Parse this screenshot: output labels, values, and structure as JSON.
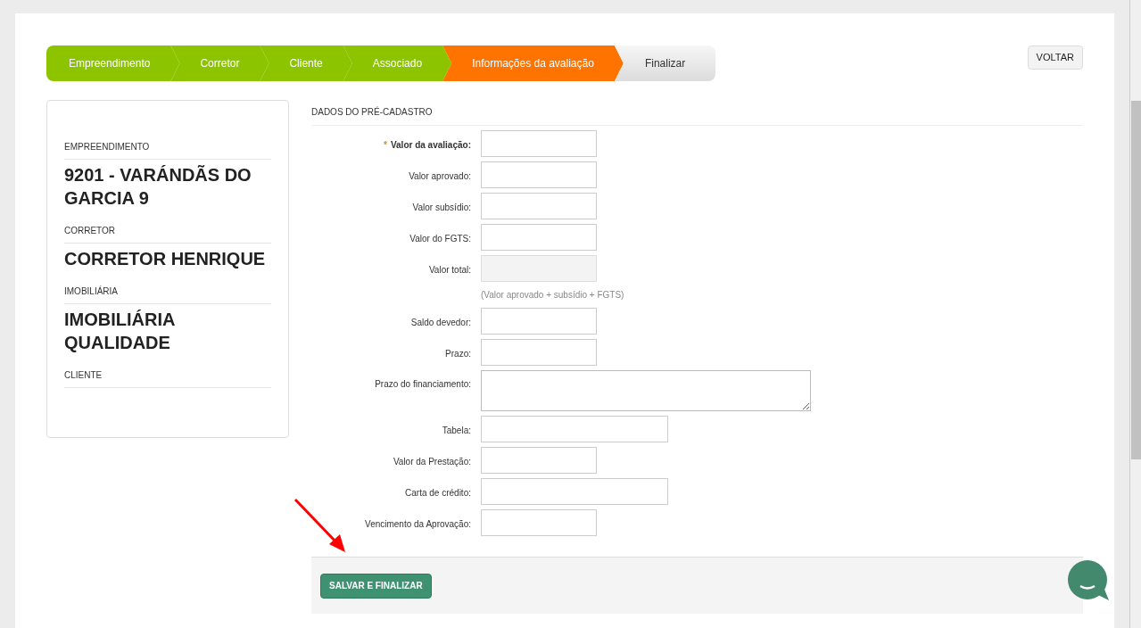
{
  "steps": [
    {
      "label": "Empreendimento",
      "selected": false
    },
    {
      "label": "Corretor",
      "selected": false
    },
    {
      "label": "Cliente",
      "selected": false
    },
    {
      "label": "Associado",
      "selected": false
    },
    {
      "label": "Informações da avaliação",
      "selected": true
    },
    {
      "label": "Finalizar",
      "selected": false
    }
  ],
  "back_button": "VOLTAR",
  "summary": [
    {
      "label": "EMPREENDIMENTO",
      "value": "9201 - VARÁNDÃS DO GARCIA 9"
    },
    {
      "label": "CORRETOR",
      "value": "CORRETOR HENRIQUE"
    },
    {
      "label": "IMOBILIÁRIA",
      "value": "IMOBILIÁRIA QUALIDADE"
    },
    {
      "label": "CLIENTE"
    }
  ],
  "form": {
    "title": "DADOS DO PRÉ-CADASTRO",
    "fields": [
      {
        "label": "Valor da avaliação:",
        "required_mark": "*",
        "kind": "short"
      },
      {
        "label": "Valor aprovado:",
        "kind": "short"
      },
      {
        "label": "Valor subsídio:",
        "kind": "short"
      },
      {
        "label": "Valor do FGTS:",
        "kind": "short"
      },
      {
        "label": "Valor total:",
        "kind": "readonly",
        "hint": "(Valor aprovado + subsídio + FGTS)"
      },
      {
        "label": "Saldo devedor:",
        "kind": "short"
      },
      {
        "label": "Prazo:",
        "kind": "short"
      },
      {
        "label": "Prazo do financiamento:",
        "kind": "textarea"
      },
      {
        "label": "Tabela:",
        "kind": "wide"
      },
      {
        "label": "Valor da Prestação:",
        "kind": "short"
      },
      {
        "label": "Carta de crédito:",
        "kind": "wide"
      },
      {
        "label": "Vencimento da Aprovação:",
        "kind": "short"
      }
    ],
    "submit": "SALVAR E FINALIZAR"
  }
}
